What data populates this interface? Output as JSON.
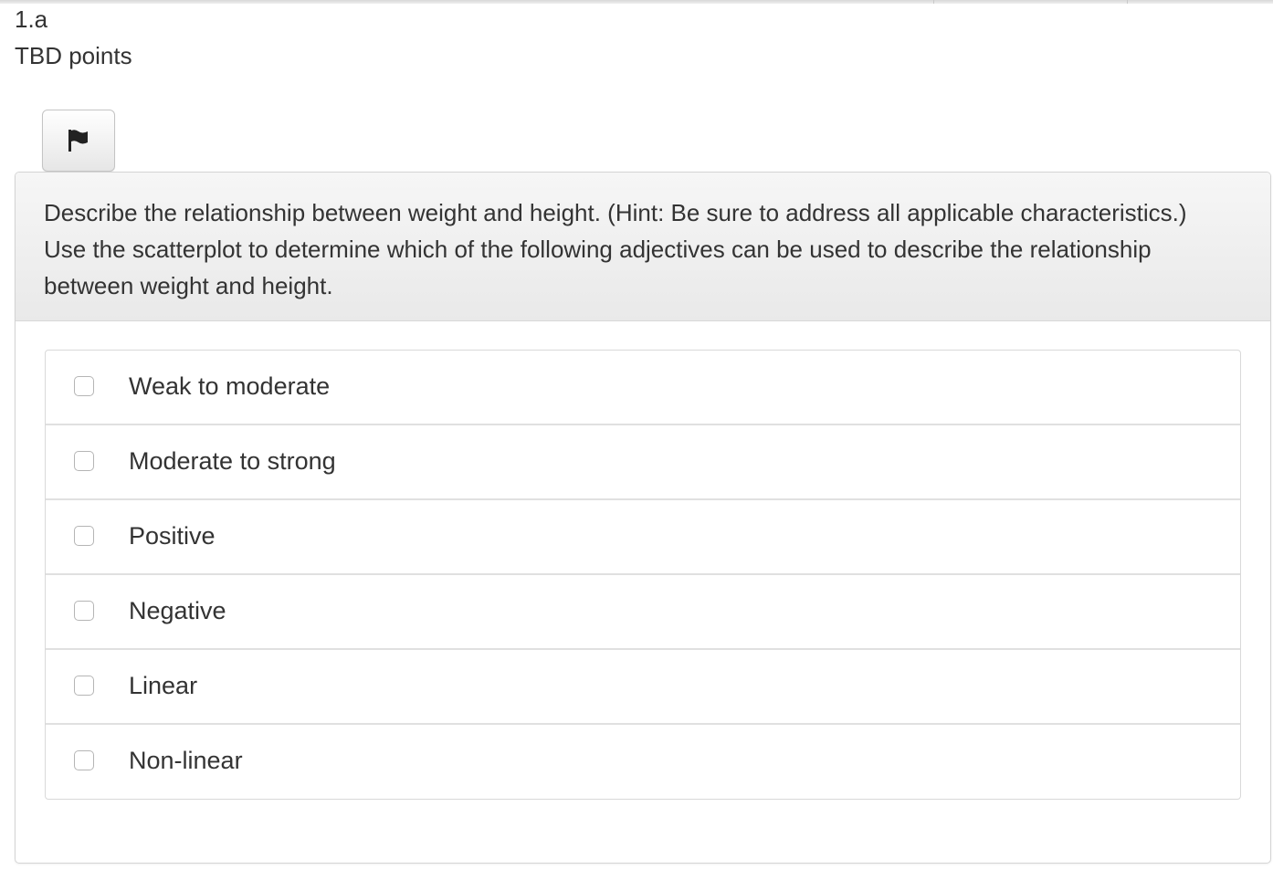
{
  "question": {
    "number": "1.a",
    "points": "TBD points",
    "flag_icon": "flag-icon",
    "prompt": "Describe the relationship between weight and height. (Hint: Be sure to address all applicable characteristics.) Use the scatterplot to determine which of the following adjectives can be used to describe the relationship between weight and height."
  },
  "options": [
    {
      "label": "Weak to moderate",
      "checked": false
    },
    {
      "label": "Moderate to strong",
      "checked": false
    },
    {
      "label": "Positive",
      "checked": false
    },
    {
      "label": "Negative",
      "checked": false
    },
    {
      "label": "Linear",
      "checked": false
    },
    {
      "label": "Non-linear",
      "checked": false
    }
  ],
  "colors": {
    "text": "#333333",
    "border": "#d9d9d9",
    "heading_bg": "#efefef"
  }
}
